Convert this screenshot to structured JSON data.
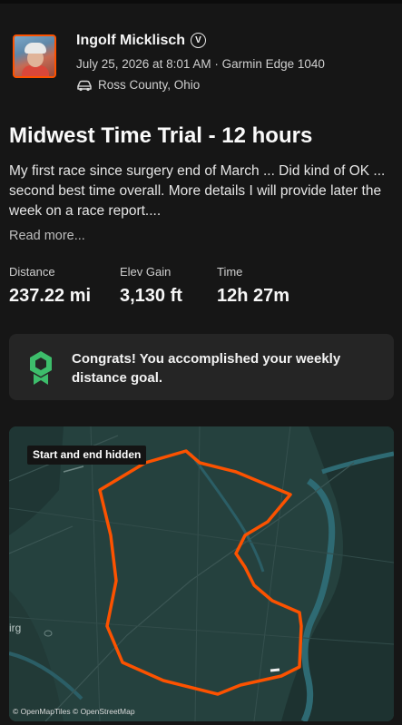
{
  "activity": {
    "athlete_name": "Ingolf Micklisch",
    "verified_glyph": "V",
    "date_device": "July 25, 2026 at 8:01 AM · Garmin Edge 1040",
    "location": "Ross County, Ohio",
    "location_icon": "car-icon",
    "title": "Midwest Time Trial - 12 hours",
    "description": "My first race since surgery end of March ... Did kind of OK ... second best time overall. More details I will provide later the week on a race report....",
    "read_more": "Read more..."
  },
  "stats": [
    {
      "label": "Distance",
      "value": "237.22 mi"
    },
    {
      "label": "Elev Gain",
      "value": "3,130 ft"
    },
    {
      "label": "Time",
      "value": "12h 27m"
    }
  ],
  "goal_banner": {
    "icon": "achievement-badge-icon",
    "text": "Congrats! You accomplished your weekly distance goal."
  },
  "map": {
    "privacy_chip": "Start and end hidden",
    "attribution": "© OpenMapTiles © OpenStreetMap",
    "place_fragment": "irg"
  },
  "colors": {
    "background": "#161616",
    "accent": "#fc5200",
    "route": "#fc5200",
    "badge_green": "#3dbd6b",
    "card": "#252525",
    "map_base": "#25413e"
  }
}
